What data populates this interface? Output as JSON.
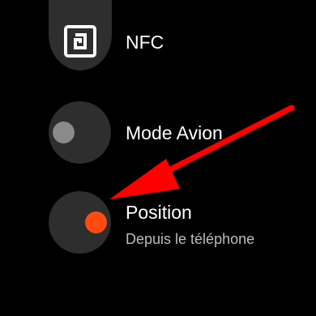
{
  "settings": {
    "items": [
      {
        "label": "NFC",
        "icon": "nfc-icon",
        "state": "off"
      },
      {
        "label": "Mode Avion",
        "icon": "airplane-toggle",
        "state": "off"
      },
      {
        "label": "Position",
        "sublabel": "Depuis le téléphone",
        "icon": "location-toggle",
        "state": "on"
      }
    ]
  },
  "colors": {
    "background": "#000000",
    "circle": "#2e2e2e",
    "knob_off": "#8a8a8a",
    "knob_on": "#ff4a12",
    "annotation_arrow": "#ff0000"
  }
}
